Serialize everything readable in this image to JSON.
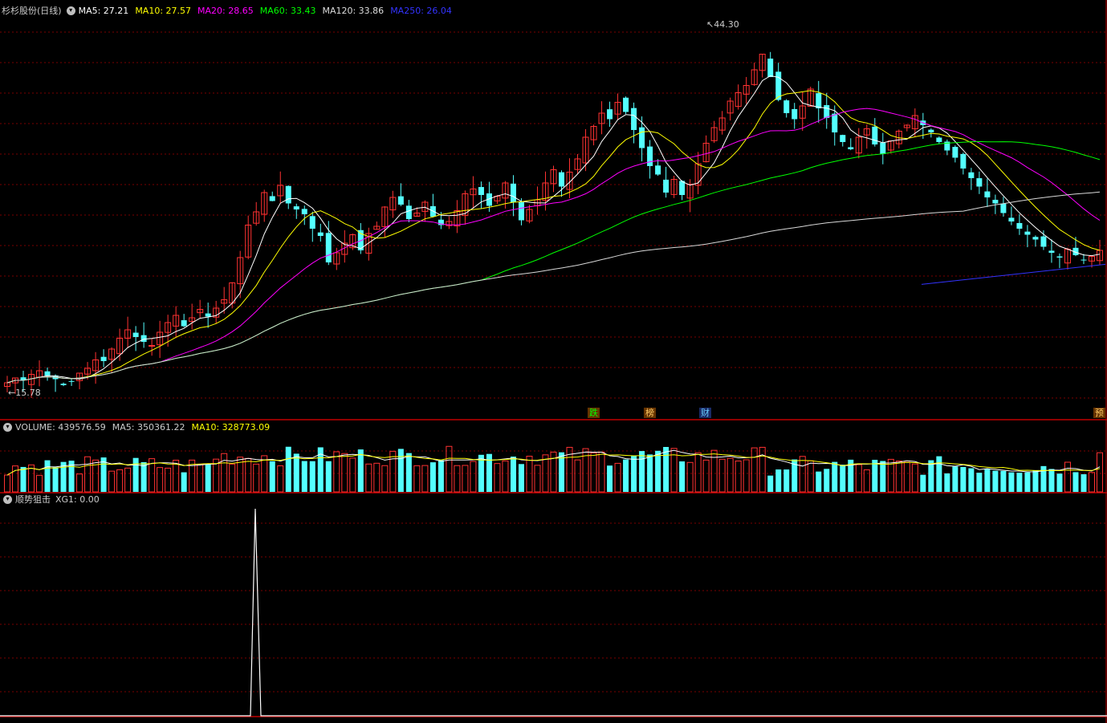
{
  "main_legend": {
    "stock": "杉杉股份(日线)",
    "ma": [
      {
        "label": "MA5: 27.21",
        "color": "#ffffff"
      },
      {
        "label": "MA10: 27.57",
        "color": "#ffff00"
      },
      {
        "label": "MA20: 28.65",
        "color": "#ff00ff"
      },
      {
        "label": "MA60: 33.43",
        "color": "#00ff00"
      },
      {
        "label": "MA120: 33.86",
        "color": "#d8d8d8"
      },
      {
        "label": "MA250: 26.04",
        "color": "#3333ff"
      }
    ]
  },
  "price_labels": {
    "high": "44.30",
    "low": "15.78"
  },
  "event_flags": [
    {
      "text": "跌",
      "color": "#00ff00",
      "bg": "#663300"
    },
    {
      "text": "榜",
      "color": "#ffcc66",
      "bg": "#663300"
    },
    {
      "text": "财",
      "color": "#66ccff",
      "bg": "#1a2a66"
    },
    {
      "text": "预",
      "color": "#ffcc66",
      "bg": "#663300"
    }
  ],
  "volume_legend": {
    "items": [
      {
        "label": "VOLUME: 439576.59",
        "color": "#cccccc"
      },
      {
        "label": "MA5: 350361.22",
        "color": "#cccccc"
      },
      {
        "label": "MA10: 328773.09",
        "color": "#ffff00"
      }
    ]
  },
  "indicator_legend": {
    "name": "顺势狙击",
    "items": [
      {
        "label": "XG1: 0.00",
        "color": "#cccccc"
      }
    ]
  },
  "colors": {
    "up": "#ff3232",
    "down": "#54ffff",
    "grid": "#7a0000",
    "divider": "#c00000"
  },
  "chart_data": {
    "type": "candlestick",
    "closes": [
      16.2,
      16.6,
      16.4,
      16.9,
      17.2,
      16.8,
      16.5,
      16.0,
      16.3,
      17.0,
      17.4,
      18.1,
      18.0,
      19.0,
      19.9,
      20.6,
      20.0,
      19.6,
      19.3,
      20.4,
      21.2,
      21.8,
      20.9,
      21.6,
      22.3,
      21.7,
      22.4,
      23.1,
      24.5,
      26.6,
      29.3,
      30.4,
      32.0,
      31.3,
      32.6,
      31.1,
      30.6,
      30.2,
      29.0,
      28.4,
      26.2,
      27.0,
      27.8,
      28.5,
      27.2,
      28.6,
      29.2,
      30.8,
      31.6,
      31.0,
      29.8,
      30.3,
      31.2,
      30.0,
      29.3,
      29.6,
      30.5,
      31.9,
      32.3,
      31.8,
      30.9,
      31.7,
      32.8,
      31.2,
      29.7,
      30.6,
      31.4,
      32.8,
      33.9,
      32.5,
      33.7,
      34.8,
      36.6,
      37.5,
      38.6,
      38.1,
      39.5,
      38.7,
      37.2,
      35.7,
      34.2,
      33.5,
      32.0,
      33.1,
      31.8,
      32.7,
      34.4,
      36.1,
      37.4,
      38.2,
      39.6,
      40.3,
      40.9,
      42.2,
      43.5,
      41.6,
      39.7,
      38.6,
      38.1,
      39.2,
      40.6,
      39.0,
      38.2,
      37.0,
      36.2,
      35.6,
      36.6,
      37.3,
      36.0,
      35.2,
      36.3,
      37.1,
      37.6,
      38.4,
      37.6,
      37.0,
      36.2,
      35.5,
      34.9,
      34.0,
      33.2,
      32.5,
      31.6,
      31.1,
      30.3,
      29.6,
      29.0,
      28.5,
      28.1,
      27.5,
      27.0,
      26.6,
      27.3,
      26.8,
      26.4,
      26.7,
      27.2
    ],
    "volume_ma5": 350361.22,
    "volume_ma10": 328773.09,
    "volume_last": 439576.59,
    "ma_last": {
      "MA5": 27.21,
      "MA10": 27.57,
      "MA20": 28.65,
      "MA60": 33.43,
      "MA120": 33.86,
      "MA250": 26.04
    },
    "high": 44.3,
    "low": 15.78,
    "indicator": {
      "name": "顺势狙击",
      "XG1": 0.0
    }
  }
}
